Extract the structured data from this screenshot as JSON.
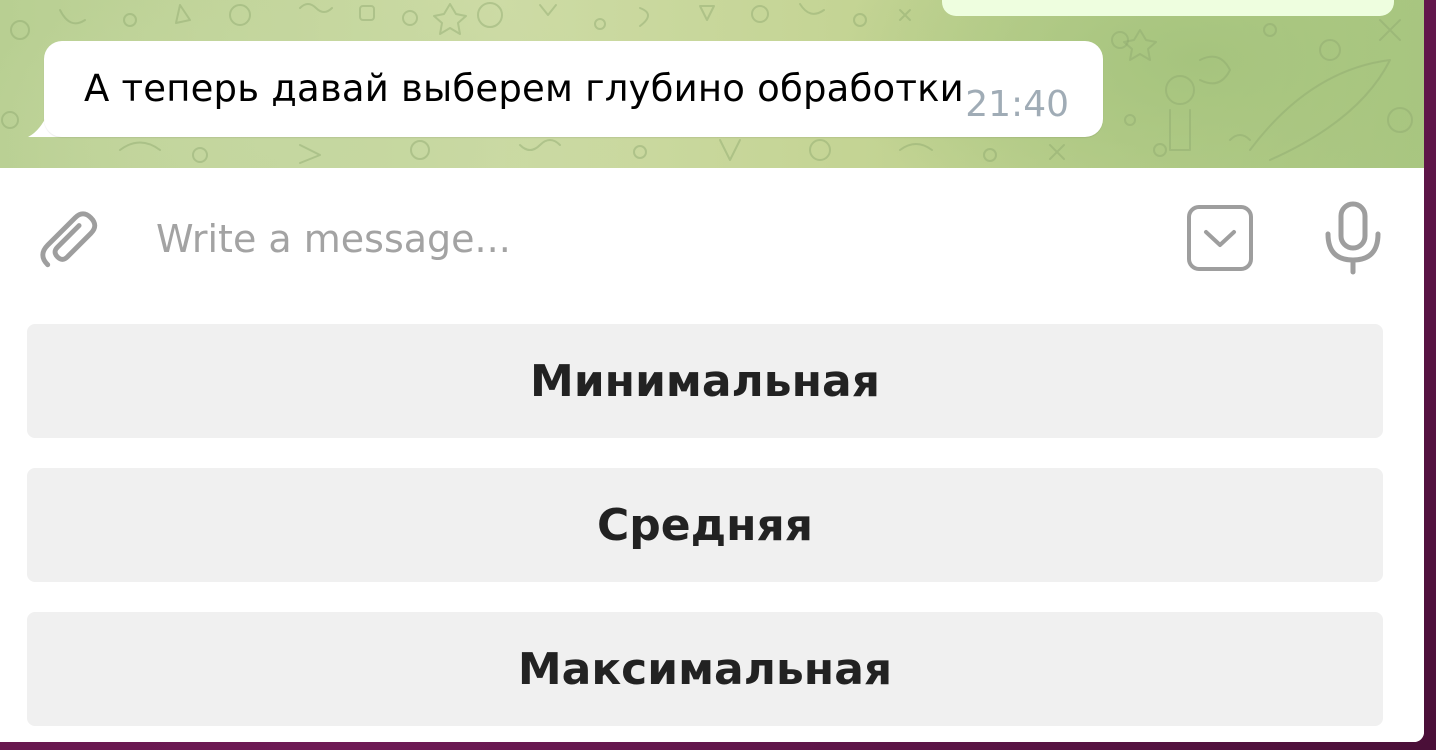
{
  "chat": {
    "incoming_message": {
      "text": "А теперь давай выберем глубино обработки",
      "time": "21:40"
    }
  },
  "composer": {
    "placeholder": "Write a message...",
    "value": "",
    "icons": {
      "attach": "paperclip-icon",
      "keyboard": "chevron-down-icon",
      "voice": "microphone-icon"
    }
  },
  "reply_keyboard": {
    "buttons": [
      {
        "label": "Минимальная"
      },
      {
        "label": "Средняя"
      },
      {
        "label": "Максимальная"
      }
    ]
  },
  "colors": {
    "bubble_incoming": "#ffffff",
    "bubble_outgoing": "#eefedf",
    "timestamp": "#a0acb6",
    "placeholder": "#a3a3a3",
    "icon": "#999999",
    "keyboard_button_bg": "#f0f0f0",
    "keyboard_button_text": "#222222",
    "wallpaper": "#c4d494",
    "desktop_background": "#5a1240"
  }
}
